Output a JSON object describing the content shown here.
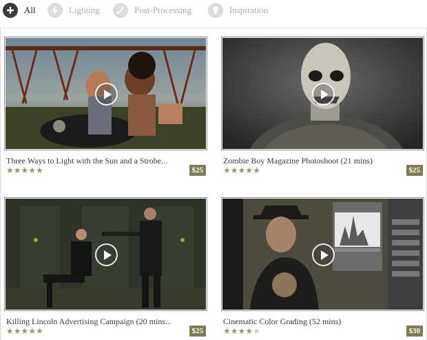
{
  "filters": [
    {
      "label": "All",
      "icon": "plus-icon",
      "active": true
    },
    {
      "label": "Lighting",
      "icon": "lightning-icon",
      "active": false
    },
    {
      "label": "Post-Processing",
      "icon": "brush-icon",
      "active": false
    },
    {
      "label": "Inspiration",
      "icon": "lightbulb-icon",
      "active": false
    }
  ],
  "videos": [
    {
      "title": "Three Ways to Light with the Sun and a Strobe...",
      "price": "$25",
      "rating": 5
    },
    {
      "title": "Zombie Boy Magazine Photoshoot (21 mins)",
      "price": "$25",
      "rating": 5
    },
    {
      "title": "Killing Lincoln Advertising Campaign (20 mins...",
      "price": "$25",
      "rating": 5
    },
    {
      "title": "Cinematic Color Grading (52 mins)",
      "price": "$30",
      "rating": 4
    }
  ],
  "colors": {
    "price_badge": "#7f7d4f",
    "star_on": "#9a9566",
    "star_off": "#cfcdbf"
  }
}
